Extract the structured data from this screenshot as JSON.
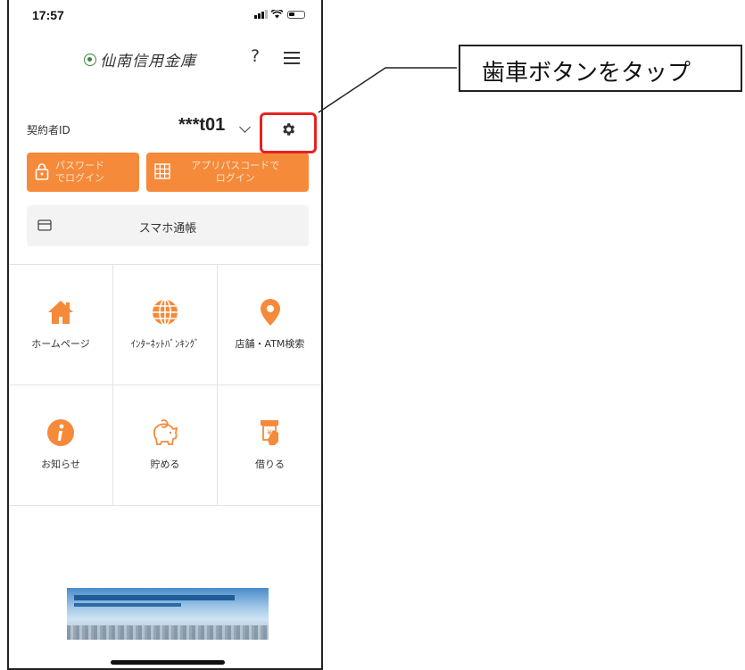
{
  "status_bar": {
    "time": "17:57"
  },
  "header": {
    "logo_text": "仙南信用金庫",
    "help_label": "?"
  },
  "contract": {
    "label": "契約者ID",
    "id_value": "***t01"
  },
  "login": {
    "password_line1": "パスワード",
    "password_line2": "でログイン",
    "passcode_line1": "アプリパスコードで",
    "passcode_line2": "ログイン"
  },
  "passbook": {
    "label": "スマホ通帳"
  },
  "menu_grid": [
    {
      "label": "ホームページ",
      "icon": "home-icon",
      "color": "#f58a3a"
    },
    {
      "label": "ｲﾝﾀｰﾈｯﾄﾊﾞﾝｷﾝｸﾞ",
      "icon": "globe-icon",
      "color": "#f58a3a"
    },
    {
      "label": "店舗・ATM検索",
      "icon": "map-pin-icon",
      "color": "#f58a3a"
    },
    {
      "label": "お知らせ",
      "icon": "info-icon",
      "color": "#f58a3a"
    },
    {
      "label": "貯める",
      "icon": "piggy-bank-icon",
      "color": "#f58a3a"
    },
    {
      "label": "借りる",
      "icon": "atm-icon",
      "color": "#f58a3a"
    }
  ],
  "callout": {
    "text": "歯車ボタンをタップ"
  },
  "colors": {
    "accent": "#f58a3a",
    "highlight": "#e52222"
  }
}
